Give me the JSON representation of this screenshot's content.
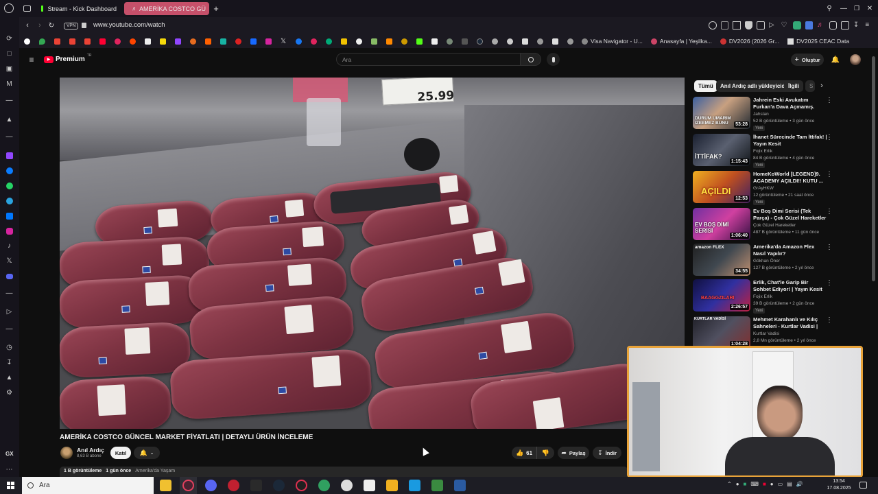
{
  "browser": {
    "tabs": [
      {
        "label": "Stream - Kick Dashboard"
      },
      {
        "label": "AMERİKA COSTCO GÜ"
      }
    ],
    "vpn_label": "VPN",
    "url": "www.youtube.com/watch",
    "bookmarks": [
      {
        "label": "Visa Navigator - U..."
      },
      {
        "label": "Anasayfa | Yeşilka..."
      },
      {
        "label": "DV2026 (2026 Gr..."
      },
      {
        "label": "DV2025 CEAC Data"
      }
    ],
    "sidebar_bottom_label": "GX"
  },
  "youtube": {
    "logo_text": "Premium",
    "logo_sup": "TR",
    "search_placeholder": "Ara",
    "create_label": "Oluştur",
    "chips": [
      {
        "label": "Tümü"
      },
      {
        "label": "Anıl Ardıç adlı yükleyiciden"
      },
      {
        "label": "İlgili"
      },
      {
        "label": "S"
      }
    ],
    "video": {
      "price_sign": "25.99",
      "title": "AMERİKA COSTCO GÜNCEL MARKET FİYATLATI | DETAYLI ÜRÜN İNCELEME",
      "channel": "Anıl Ardıç",
      "subscribers": "8,63 B abone",
      "join_label": "Katıl",
      "likes": "61",
      "share_label": "Paylaş",
      "download_label": "İndir",
      "views": "1 B görüntüleme",
      "age": "1 gün önce",
      "tag": "Amerika'da Yaşam"
    },
    "recommendations": [
      {
        "title": "Jahrein Eski Avukatım Furkan'a Dava Açmamış. Videosunu ...",
        "channel": "Jahstan",
        "meta": "52 B görüntüleme • 3 gün önce",
        "duration": "53:28",
        "badge": "Yeni",
        "thumb_text": "DURUM UMARIM\nIZEEMEZ BUNU"
      },
      {
        "title": "İhanet Sürecinde Tam İttifak! | Yayın Kesit",
        "channel": "Fojix Erlik",
        "meta": "84 B görüntüleme • 4 gün önce",
        "duration": "1:15:43",
        "badge": "Yeni",
        "thumb_text": "İTTİFAK?"
      },
      {
        "title": "HomeKoWorld [LEGEND]9. ACADEMY AÇILDI!! KUTU ...",
        "channel": "GrAyHKW",
        "meta": "12 görüntüleme • 21 saat önce",
        "duration": "12:53",
        "badge": "Yeni",
        "thumb_text": "AÇILDI"
      },
      {
        "title": "Ev Boş Dimi Serisi (Tek Parça) - Çok Güzel Hareketler 2",
        "channel": "Çok Güzel Hareketler",
        "meta": "487 B görüntüleme • 11 gün önce",
        "duration": "1:06:40",
        "badge": "",
        "thumb_text": "EV BOŞ DİMİ\nSERİSİ"
      },
      {
        "title": "Amerika'da Amazon Flex Nasıl Yapılır?",
        "channel": "Gökhan Öner",
        "meta": "127 B görüntüleme • 2 yıl önce",
        "duration": "34:55",
        "badge": "",
        "thumb_text": "amazon FLEX"
      },
      {
        "title": "Erlik, Chat'le Garip Bir Sohbet Ediyor! | Yayın Kesit",
        "channel": "Fojix Erlik",
        "meta": "39 B görüntüleme • 2 gün önce",
        "duration": "2:26:57",
        "badge": "Yeni",
        "thumb_text": "BAAGGZILARI"
      },
      {
        "title": "Mehmet Karahanlı ve Kılıç Sahneleri - Kurtlar Vadisi | Öze...",
        "channel": "Kurtlar Vadisi",
        "meta": "2,8 Mn görüntüleme • 2 yıl önce",
        "duration": "1:04:28",
        "badge": "",
        "thumb_text": "KURTLAR VADİSİ"
      }
    ]
  },
  "taskbar": {
    "search_placeholder": "Ara",
    "time": "13:54",
    "date": "17.08.2025"
  },
  "colors": {
    "youtube_red": "#ff0033",
    "tab_active": "#c6506a",
    "webcam_border": "#e8a33a"
  }
}
